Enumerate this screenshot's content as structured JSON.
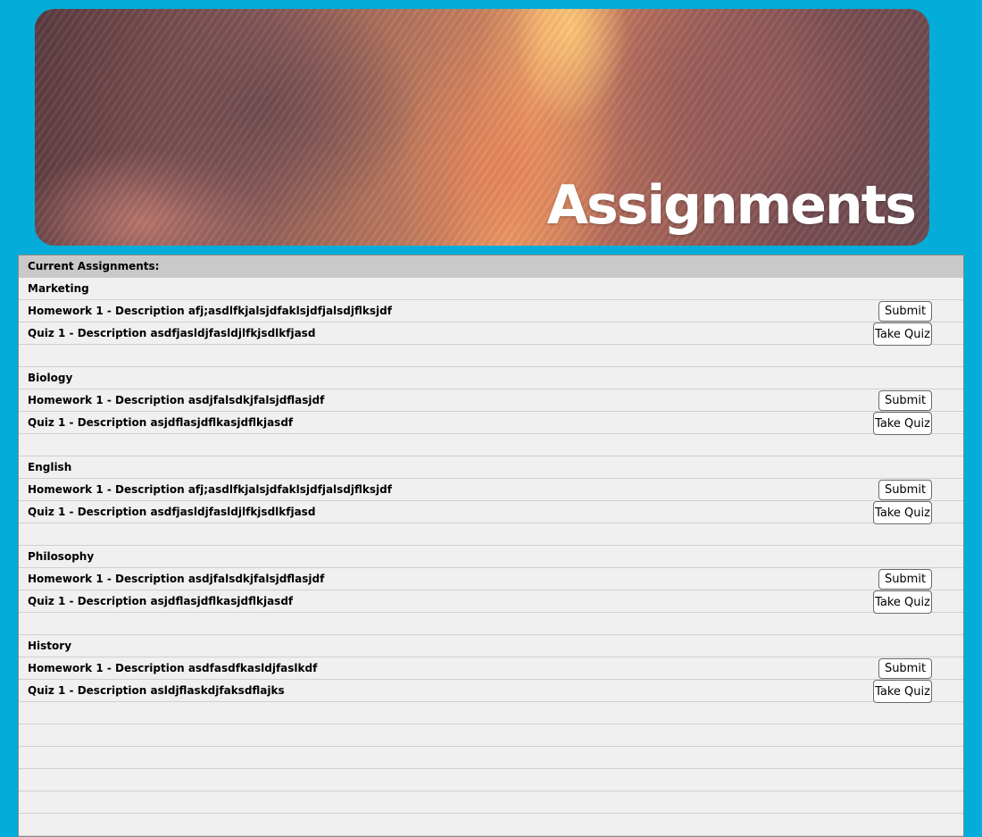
{
  "banner": {
    "title": "Assignments"
  },
  "list": {
    "header": "Current Assignments:",
    "courses": [
      {
        "name": "Marketing",
        "homework": {
          "text": "Homework 1 - Description afj;asdlfkjalsjdfaklsjdfjalsdjflksjdf",
          "button": "Submit"
        },
        "quiz": {
          "text": "Quiz 1 - Description asdfjasldjfasldjlfkjsdlkfjasd",
          "button": "Take Quiz"
        }
      },
      {
        "name": "Biology",
        "homework": {
          "text": "Homework 1 - Description asdjfalsdkjfalsjdflasjdf",
          "button": "Submit"
        },
        "quiz": {
          "text": "Quiz 1 - Description asjdflasjdflkasjdflkjasdf",
          "button": "Take Quiz"
        }
      },
      {
        "name": "English",
        "homework": {
          "text": "Homework 1 - Description afj;asdlfkjalsjdfaklsjdfjalsdjflksjdf",
          "button": "Submit"
        },
        "quiz": {
          "text": "Quiz 1 - Description asdfjasldjfasldjlfkjsdlkfjasd",
          "button": "Take Quiz"
        }
      },
      {
        "name": "Philosophy",
        "homework": {
          "text": "Homework 1 - Description asdjfalsdkjfalsjdflasjdf",
          "button": "Submit"
        },
        "quiz": {
          "text": "Quiz 1 - Description asjdflasjdflkasjdflkjasdf",
          "button": "Take Quiz"
        }
      },
      {
        "name": "History",
        "homework": {
          "text": "Homework 1 - Description asdfasdfkasldjfaslkdf",
          "button": "Submit"
        },
        "quiz": {
          "text": "Quiz 1 - Description asldjflaskdjfaksdflajks",
          "button": "Take Quiz"
        }
      }
    ]
  },
  "colors": {
    "background": "#04acd9",
    "panel": "#f0f0f0",
    "header_row": "#c9c9c9"
  }
}
